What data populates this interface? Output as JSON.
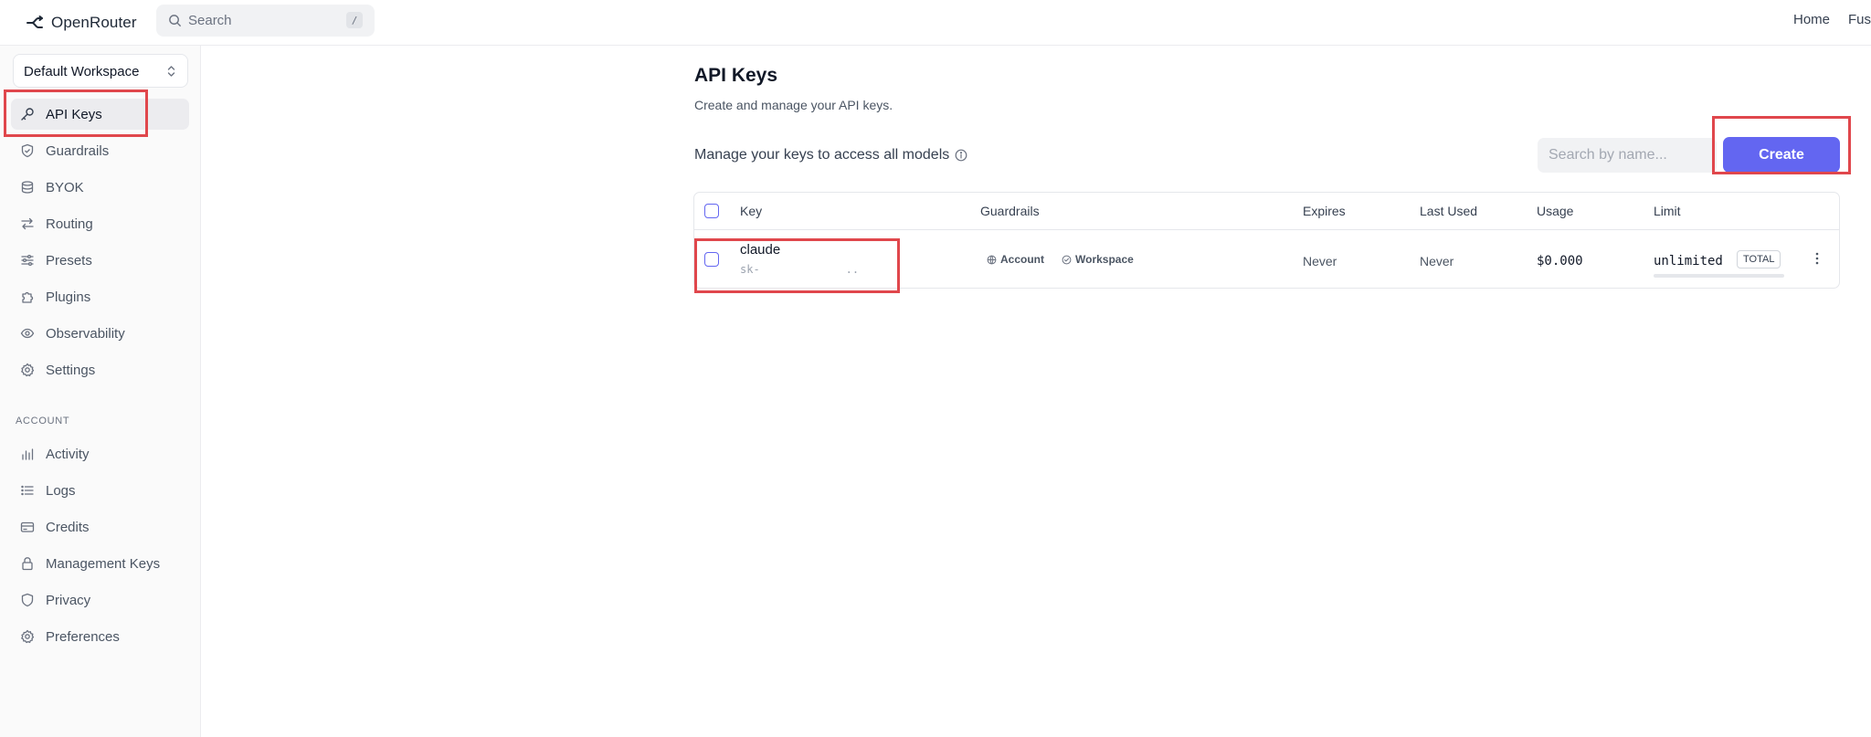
{
  "app": {
    "name": "OpenRouter",
    "search_placeholder": "Search",
    "search_shortcut": "/",
    "nav": [
      "Home",
      "Fus"
    ]
  },
  "sidebar": {
    "workspace": "Default Workspace",
    "items": [
      {
        "label": "API Keys",
        "icon": "key-icon",
        "active": true
      },
      {
        "label": "Guardrails",
        "icon": "shield-icon"
      },
      {
        "label": "BYOK",
        "icon": "database-icon"
      },
      {
        "label": "Routing",
        "icon": "arrows-swap-icon"
      },
      {
        "label": "Presets",
        "icon": "sliders-icon"
      },
      {
        "label": "Plugins",
        "icon": "puzzle-icon"
      },
      {
        "label": "Observability",
        "icon": "eye-icon"
      },
      {
        "label": "Settings",
        "icon": "gear-icon"
      }
    ],
    "section_label": "ACCOUNT",
    "account_items": [
      {
        "label": "Activity",
        "icon": "bar-chart-icon"
      },
      {
        "label": "Logs",
        "icon": "list-icon"
      },
      {
        "label": "Credits",
        "icon": "credit-card-icon"
      },
      {
        "label": "Management Keys",
        "icon": "lock-icon"
      },
      {
        "label": "Privacy",
        "icon": "shield-icon"
      },
      {
        "label": "Preferences",
        "icon": "gear-icon"
      }
    ]
  },
  "main": {
    "title": "API Keys",
    "subtitle": "Create and manage your API keys.",
    "manage_text": "Manage your keys to access all models",
    "filter_placeholder": "Search by name...",
    "create_label": "Create",
    "table": {
      "headers": [
        "Key",
        "Guardrails",
        "Expires",
        "Last Used",
        "Usage",
        "Limit"
      ],
      "rows": [
        {
          "name": "claude",
          "key_masked": "sk-             ..",
          "guardrails": [
            "Account",
            "Workspace"
          ],
          "expires": "Never",
          "last_used": "Never",
          "usage": "$0.000",
          "limit": "unlimited",
          "limit_badge": "TOTAL",
          "limit_used_fraction": 0
        }
      ]
    }
  },
  "colors": {
    "accent": "#6366f1",
    "highlight": "#e0474c"
  }
}
